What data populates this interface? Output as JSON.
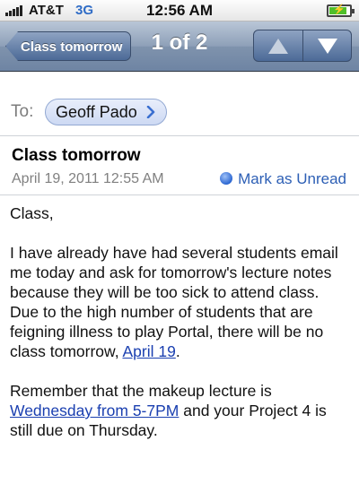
{
  "status_bar": {
    "carrier": "AT&T",
    "network": "3G",
    "time": "12:56 AM",
    "battery_level": 0.8,
    "battery_charging": true
  },
  "nav_bar": {
    "back_label": "Class tomorrow",
    "counter": "1 of 2",
    "prev_icon": "up-arrow-icon",
    "next_icon": "down-arrow-icon"
  },
  "header": {
    "to_label": "To:",
    "recipient": "Geoff Pado",
    "subject": "Class tomorrow",
    "date": "April 19, 2011 12:55 AM",
    "mark_unread": "Mark as Unread"
  },
  "body": {
    "greeting": "Class,",
    "p1_text": "I have already have had several students email me today and ask for tomorrow's lecture notes because they will be too sick to attend class. Due to the high number of students that are feigning illness to play Portal, there will be no class tomorrow, ",
    "p1_link": "April 19",
    "p1_end": ".",
    "p2_text": "Remember that the makeup lecture is ",
    "p2_link": "Wednesday from 5-7PM",
    "p2_end": " and your Project 4 is still due on Thursday."
  },
  "colors": {
    "link": "#1a3fb0",
    "network": "#2f6cc6",
    "nav_bar": "#7f93ad",
    "unread_dot": "#2c67d2"
  }
}
